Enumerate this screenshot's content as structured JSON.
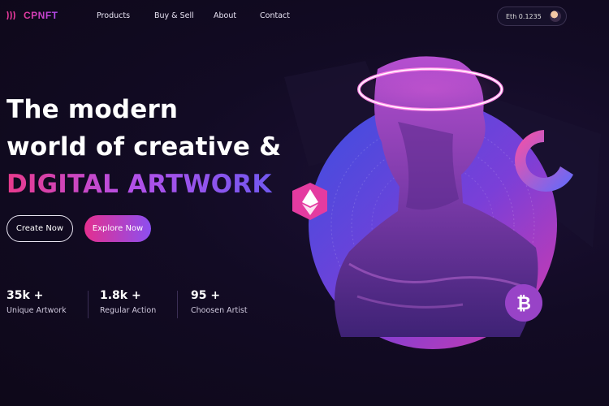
{
  "nav": {
    "logo": "CPNFT",
    "links": [
      "Products",
      "Buy & Sell",
      "About",
      "Contact"
    ],
    "wallet": "Eth 0.1235"
  },
  "hero": {
    "line1": "The modern",
    "line2": "world of creative &",
    "line3": "DIGITAL ARTWORK",
    "create_button": "Create Now",
    "explore_button": "Explore Now"
  },
  "stats": [
    {
      "value": "35k +",
      "label": "Unique Artwork"
    },
    {
      "value": "1.8k +",
      "label": "Regular Action"
    },
    {
      "value": "95 +",
      "label": "Choosen Artist"
    }
  ],
  "colors": {
    "background": "#100a1f",
    "accent_pink": "#e42f8f",
    "accent_purple": "#8c4ff0",
    "circle_blue": "#3a4fe0"
  },
  "icons": {
    "ethereum_badge": "ethereum-icon",
    "bitcoin_badge": "bitcoin-icon",
    "wallet_avatar": "avatar"
  }
}
